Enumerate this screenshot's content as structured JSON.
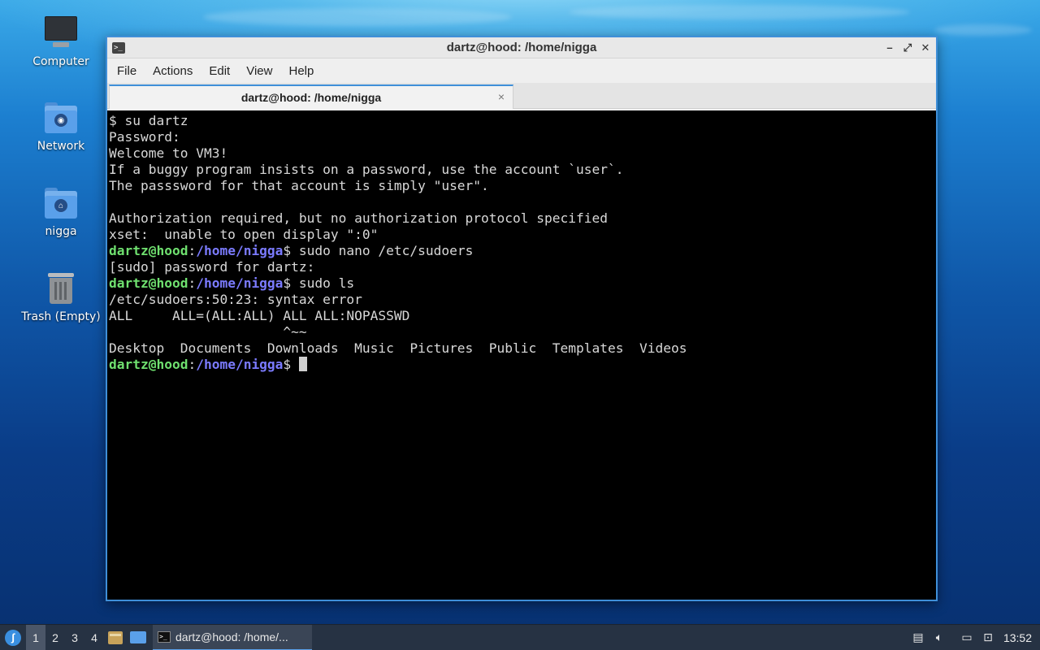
{
  "desktop": {
    "icons": [
      {
        "label": "Computer",
        "icon": "computer-icon"
      },
      {
        "label": "Network",
        "icon": "network-folder-icon"
      },
      {
        "label": "nigga",
        "icon": "home-folder-icon"
      },
      {
        "label": "Trash (Empty)",
        "icon": "trash-icon"
      }
    ]
  },
  "window": {
    "title": "dartz@hood: /home/nigga",
    "menu": [
      "File",
      "Actions",
      "Edit",
      "View",
      "Help"
    ],
    "tab_label": "dartz@hood: /home/nigga",
    "tab_close": "×",
    "buttons": {
      "minimize": "–",
      "maximize": "⤢",
      "close": "✕"
    }
  },
  "terminal": {
    "prompt_user": "dartz@hood",
    "prompt_path": "/home/nigga",
    "lines": [
      "$ su dartz",
      "Password:",
      "Welcome to VM3!",
      "If a buggy program insists on a password, use the account `user`.",
      "The passsword for that account is simply \"user\".",
      "",
      "Authorization required, but no authorization protocol specified",
      "xset:  unable to open display \":0\""
    ],
    "cmd1": " sudo nano /etc/sudoers",
    "line_sudo": "[sudo] password for dartz:",
    "cmd2": " sudo ls",
    "err1": "/etc/sudoers:50:23: syntax error",
    "err2": "ALL     ALL=(ALL:ALL) ALL ALL:NOPASSWD",
    "err3": "                      ^~~",
    "ls_output": "Desktop  Documents  Downloads  Music  Pictures  Public  Templates  Videos"
  },
  "taskbar": {
    "workspaces": [
      "1",
      "2",
      "3",
      "4"
    ],
    "active_workspace": "1",
    "task_label": "dartz@hood: /home/...",
    "clock": "13:52"
  }
}
